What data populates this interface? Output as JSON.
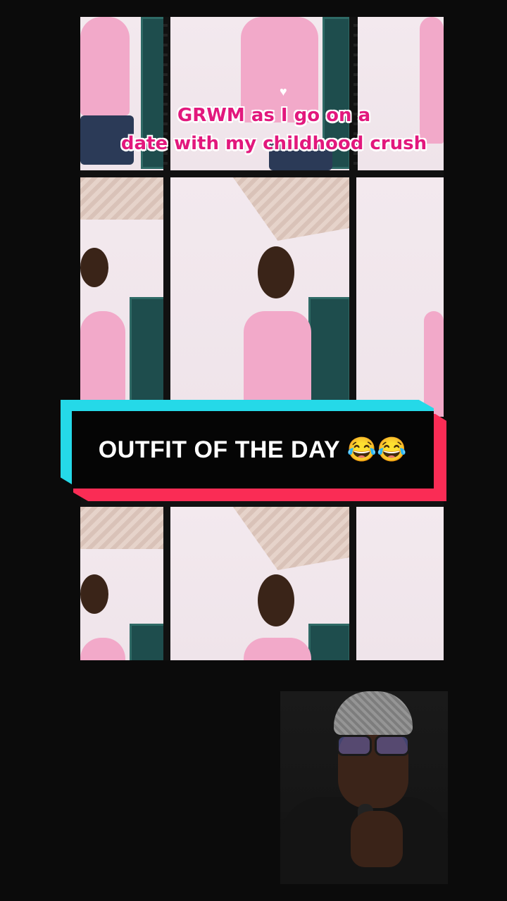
{
  "video": {
    "caption_line1": "GRWM as I go on a",
    "caption_line2": "date with my childhood crush",
    "heart_symbol": "♥"
  },
  "banner": {
    "text": "OUTFIT OF THE DAY 😂😂",
    "colors": {
      "cyan": "#25d9e8",
      "red": "#fa2c55",
      "black": "#050505"
    }
  },
  "colors": {
    "background": "#0b0b0b",
    "caption_pink": "#e2187d",
    "top_pink": "#f2a9c9"
  }
}
